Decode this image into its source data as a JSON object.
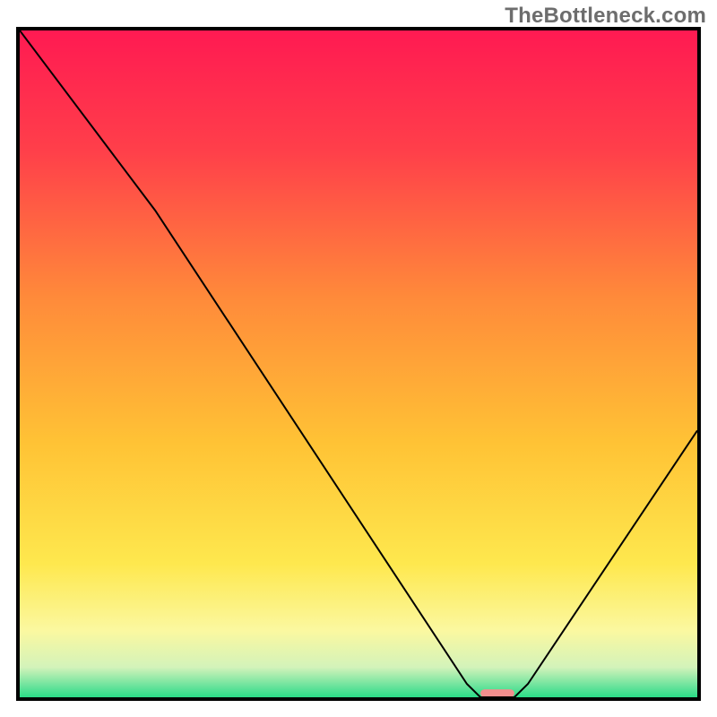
{
  "watermark": "TheBottleneck.com",
  "chart_data": {
    "type": "line",
    "title": "",
    "xlabel": "",
    "ylabel": "",
    "xlim": [
      0,
      100
    ],
    "ylim": [
      0,
      100
    ],
    "grid": false,
    "legend": false,
    "series": [
      {
        "name": "bottleneck-curve",
        "x": [
          0,
          20,
          66,
          68,
          73,
          75,
          100
        ],
        "values": [
          100,
          73,
          2,
          0,
          0,
          2,
          40
        ],
        "stroke": "#000000",
        "stroke_width": 2
      }
    ],
    "highlight": {
      "name": "optimal-range-marker",
      "x_start": 68,
      "x_end": 73,
      "y": 0.6,
      "color": "#f28e8e"
    },
    "background_gradient": {
      "direction": "vertical",
      "stops": [
        {
          "offset": 0.0,
          "color": "#ff1a52"
        },
        {
          "offset": 0.18,
          "color": "#ff3f4a"
        },
        {
          "offset": 0.4,
          "color": "#ff8a3a"
        },
        {
          "offset": 0.62,
          "color": "#ffc335"
        },
        {
          "offset": 0.8,
          "color": "#fee84e"
        },
        {
          "offset": 0.9,
          "color": "#fbf8a0"
        },
        {
          "offset": 0.955,
          "color": "#d3f3ba"
        },
        {
          "offset": 0.985,
          "color": "#63e29a"
        },
        {
          "offset": 1.0,
          "color": "#2bdc87"
        }
      ]
    }
  }
}
